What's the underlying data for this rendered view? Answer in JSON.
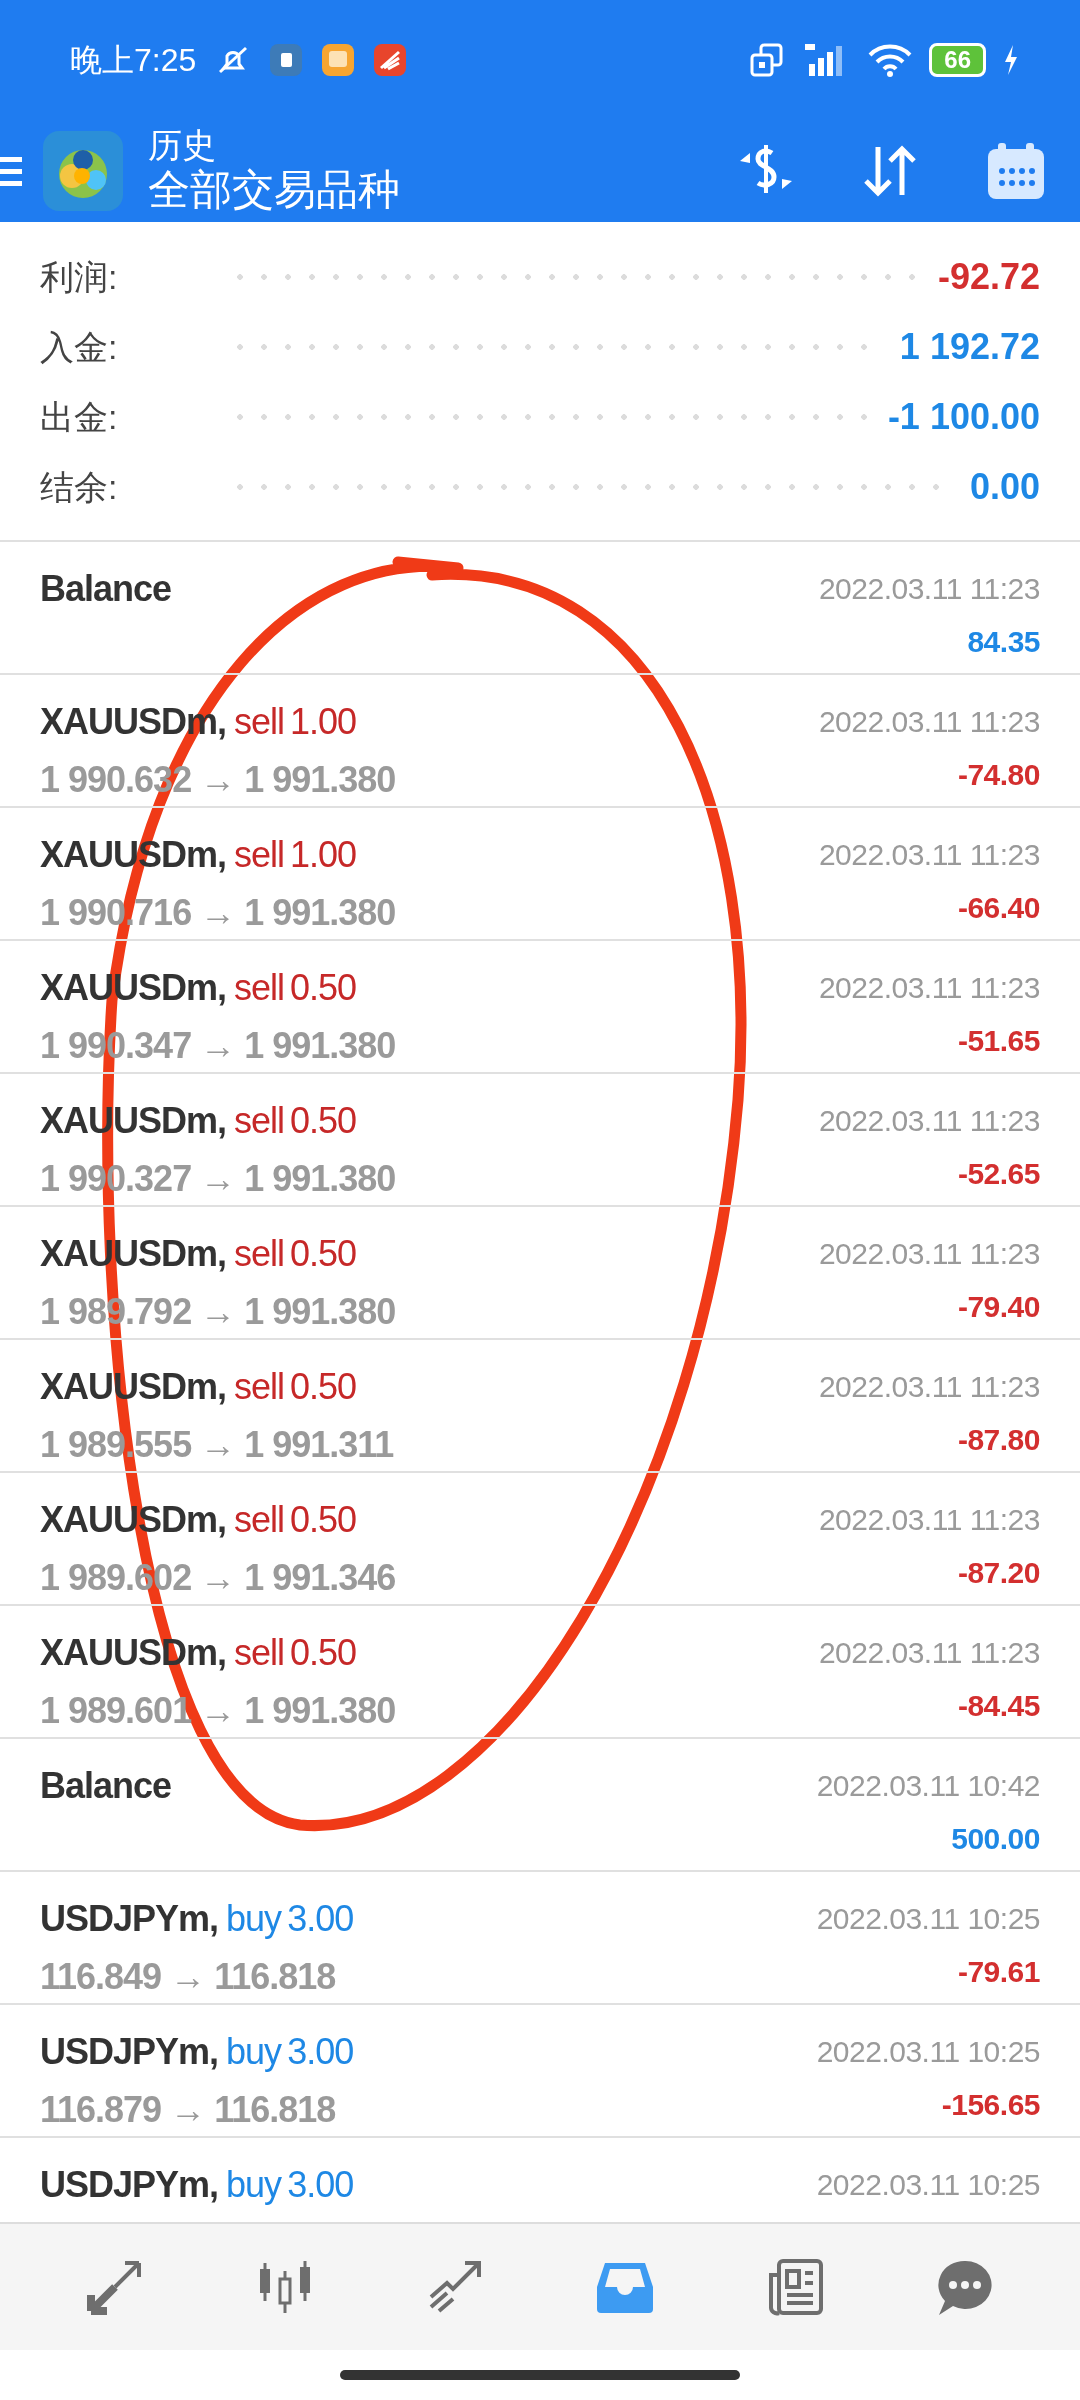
{
  "status_bar": {
    "time": "晚上7:25",
    "battery": "66"
  },
  "app_bar": {
    "title": "历史",
    "subtitle": "全部交易品种"
  },
  "summary": [
    {
      "label": "利润:",
      "value": "-92.72",
      "color": "#d32f2f"
    },
    {
      "label": "入金:",
      "value": "1 192.72",
      "color": "#1e88e5"
    },
    {
      "label": "出金:",
      "value": "-1 100.00",
      "color": "#1e88e5"
    },
    {
      "label": "结余:",
      "value": "0.00",
      "color": "#1e88e5"
    }
  ],
  "history": [
    {
      "kind": "balance",
      "title": "Balance",
      "time": "2022.03.11 11:23",
      "amount": "84.35",
      "color": "#1e88e5"
    },
    {
      "kind": "trade",
      "symbol": "XAUUSDm,",
      "side": "sell",
      "volume": "1.00",
      "prices": "1 990.632 → 1 991.380",
      "time": "2022.03.11 11:23",
      "amount": "-74.80",
      "color": "#d32f2f"
    },
    {
      "kind": "trade",
      "symbol": "XAUUSDm,",
      "side": "sell",
      "volume": "1.00",
      "prices": "1 990.716 → 1 991.380",
      "time": "2022.03.11 11:23",
      "amount": "-66.40",
      "color": "#d32f2f"
    },
    {
      "kind": "trade",
      "symbol": "XAUUSDm,",
      "side": "sell",
      "volume": "0.50",
      "prices": "1 990.347 → 1 991.380",
      "time": "2022.03.11 11:23",
      "amount": "-51.65",
      "color": "#d32f2f"
    },
    {
      "kind": "trade",
      "symbol": "XAUUSDm,",
      "side": "sell",
      "volume": "0.50",
      "prices": "1 990.327 → 1 991.380",
      "time": "2022.03.11 11:23",
      "amount": "-52.65",
      "color": "#d32f2f"
    },
    {
      "kind": "trade",
      "symbol": "XAUUSDm,",
      "side": "sell",
      "volume": "0.50",
      "prices": "1 989.792 → 1 991.380",
      "time": "2022.03.11 11:23",
      "amount": "-79.40",
      "color": "#d32f2f"
    },
    {
      "kind": "trade",
      "symbol": "XAUUSDm,",
      "side": "sell",
      "volume": "0.50",
      "prices": "1 989.555 → 1 991.311",
      "time": "2022.03.11 11:23",
      "amount": "-87.80",
      "color": "#d32f2f"
    },
    {
      "kind": "trade",
      "symbol": "XAUUSDm,",
      "side": "sell",
      "volume": "0.50",
      "prices": "1 989.602 → 1 991.346",
      "time": "2022.03.11 11:23",
      "amount": "-87.20",
      "color": "#d32f2f"
    },
    {
      "kind": "trade",
      "symbol": "XAUUSDm,",
      "side": "sell",
      "volume": "0.50",
      "prices": "1 989.601 → 1 991.380",
      "time": "2022.03.11 11:23",
      "amount": "-84.45",
      "color": "#d32f2f"
    },
    {
      "kind": "balance",
      "title": "Balance",
      "time": "2022.03.11 10:42",
      "amount": "500.00",
      "color": "#1e88e5"
    },
    {
      "kind": "trade",
      "symbol": "USDJPYm,",
      "side": "buy",
      "volume": "3.00",
      "prices": "116.849 → 116.818",
      "time": "2022.03.11 10:25",
      "amount": "-79.61",
      "color": "#d32f2f"
    },
    {
      "kind": "trade",
      "symbol": "USDJPYm,",
      "side": "buy",
      "volume": "3.00",
      "prices": "116.879 → 116.818",
      "time": "2022.03.11 10:25",
      "amount": "-156.65",
      "color": "#d32f2f"
    },
    {
      "kind": "trade",
      "symbol": "USDJPYm,",
      "side": "buy",
      "volume": "3.00",
      "time": "2022.03.11 10:25"
    }
  ],
  "bottom_nav": [
    {
      "selected": false
    },
    {
      "selected": false
    },
    {
      "selected": false
    },
    {
      "selected": true
    },
    {
      "selected": false
    },
    {
      "selected": false
    }
  ]
}
